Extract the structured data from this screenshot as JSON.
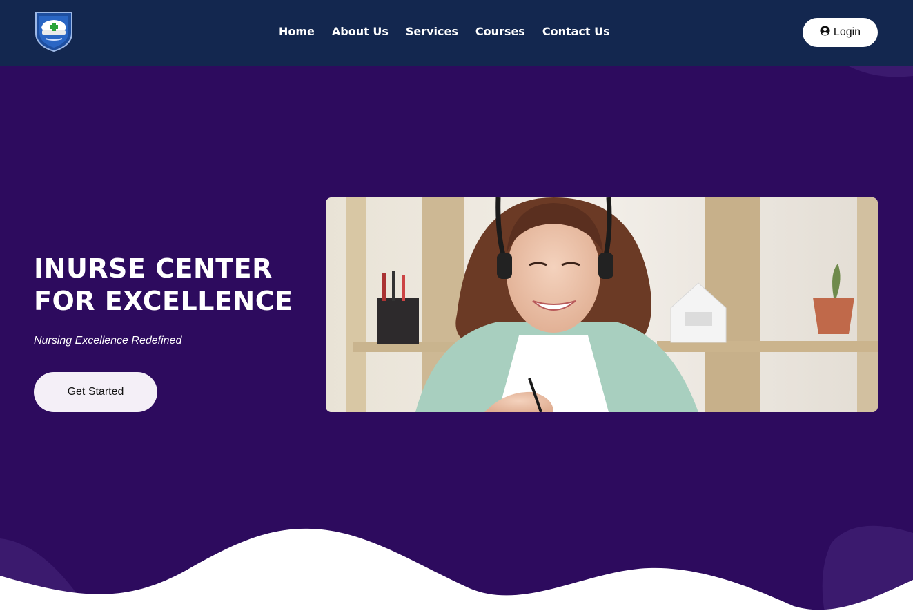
{
  "header": {
    "logo_icon": "nurse-cap-shield-icon",
    "nav": [
      {
        "label": "Home"
      },
      {
        "label": "About Us"
      },
      {
        "label": "Services"
      },
      {
        "label": "Courses"
      },
      {
        "label": "Contact Us"
      }
    ],
    "login": {
      "label": "Login",
      "icon": "user-circle-icon"
    }
  },
  "hero": {
    "title_line1": "INURSE CENTER",
    "title_line2": "FOR EXCELLENCE",
    "subtitle": "Nursing Excellence Redefined",
    "cta_label": "Get Started",
    "image_subject": "student-with-headset-photo"
  },
  "colors": {
    "navbar": "#13274f",
    "hero": "#2d0b5e",
    "accent_shape": "#3b1a6e",
    "button_bg": "#f4eff7"
  }
}
